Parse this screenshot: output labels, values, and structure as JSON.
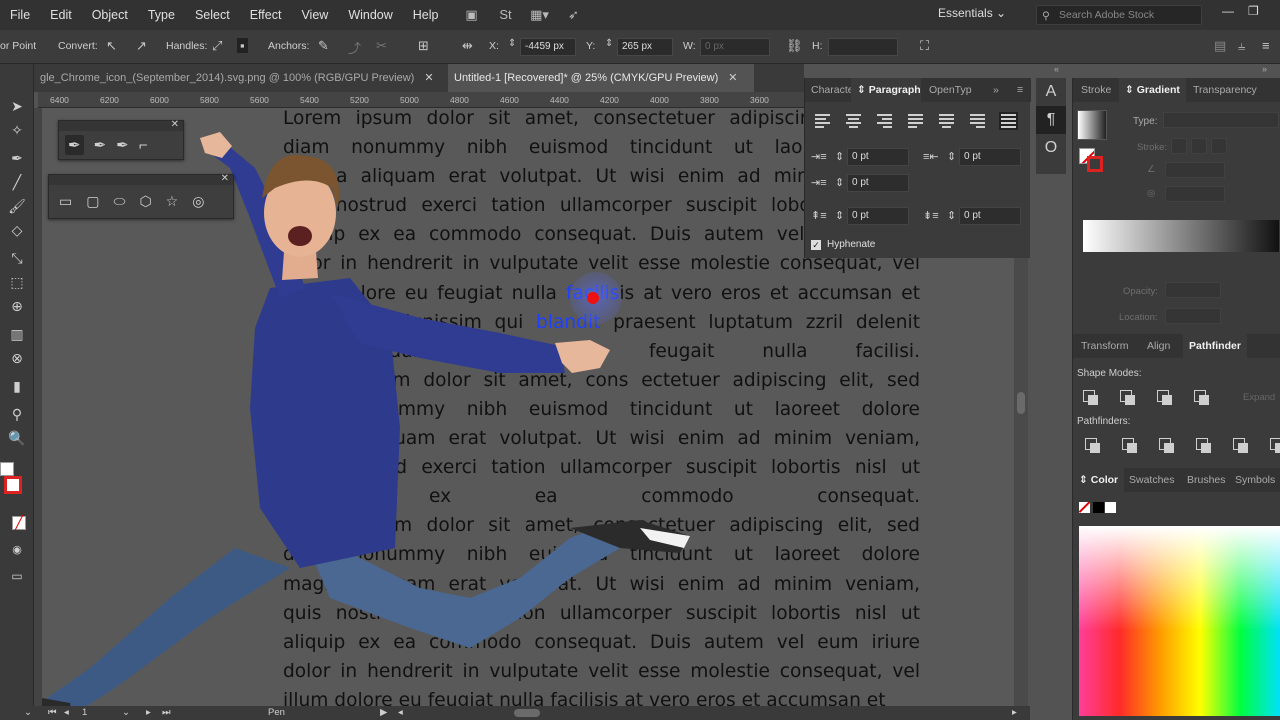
{
  "menubar": {
    "items": [
      "File",
      "Edit",
      "Object",
      "Type",
      "Select",
      "Effect",
      "View",
      "Window",
      "Help"
    ],
    "workspace": "Essentials",
    "search_placeholder": "Search Adobe Stock"
  },
  "control": {
    "anchor_point": "or Point",
    "convert": "Convert:",
    "handles": "Handles:",
    "anchors": "Anchors:",
    "x_label": "X:",
    "x_value": "-4459 px",
    "y_label": "Y:",
    "y_value": "265 px",
    "w_label": "W:",
    "w_value": "0 px",
    "h_label": "H:"
  },
  "tabs": [
    {
      "label": "gle_Chrome_icon_(September_2014).svg.png @ 100% (RGB/GPU Preview)"
    },
    {
      "label": "Untitled-1 [Recovered]* @ 25% (CMYK/GPU Preview)"
    }
  ],
  "ruler_ticks": [
    "6400",
    "6200",
    "6000",
    "5800",
    "5600",
    "5400",
    "5200",
    "5000",
    "4800",
    "4600",
    "4400",
    "4200",
    "4000",
    "3800",
    "3600"
  ],
  "canvas_text": [
    "Lorem ipsum dolor sit amet, consectetuer adipiscing elit, sed",
    "diam nonummy nibh euismod tincidunt ut laoreet dolore",
    "magna aliquam erat volutpat. Ut wisi enim ad minim veniam,",
    "quis nostrud exerci tation ullamcorper suscipit lobortis nisl ut",
    "aliquip ex ea commodo consequat. Duis autem vel eum iriure",
    "dolor in hendrerit in vulputate velit esse molestie consequat, vel",
    "illum dolore eu feugiat nulla facilisis at vero eros et accumsan et",
    "iusto odio dignissim qui blandit praesent luptatum zzril delenit",
    "augue duis dolore te feugait nulla facilisi.",
    "Lorem ipsum dolor sit amet, cons ectetuer adipiscing elit, sed",
    "diam nonummy nibh euismod tincidunt ut laoreet dolore",
    "magna aliquam erat volutpat. Ut wisi enim ad minim veniam,",
    "quis nostrud exerci tation ullamcorper suscipit lobortis nisl ut",
    "aliquip ex ea commodo consequat.",
    "Lorem ipsum dolor sit amet, consectetuer adipiscing elit, sed",
    "diam nonummy nibh euismod tincidunt ut laoreet dolore",
    "magna aliquam erat volutpat. Ut wisi enim ad minim veniam,",
    "quis nostrud exerci tation ullamcorper suscipit lobortis nisl ut",
    "aliquip ex ea commodo consequat. Duis autem vel eum iriure",
    "dolor in hendrerit in vulputate velit esse molestie consequat, vel",
    "illum dolore eu feugiat nulla facilisis at vero eros et accumsan et"
  ],
  "highlight": {
    "word1": "facilis",
    "word2": "blandit"
  },
  "paragraph_panel": {
    "tabs": [
      "Characte",
      "Paragraph",
      "OpenTyp"
    ],
    "left_indent": "0 pt",
    "right_indent": "0 pt",
    "first_line_indent": "0 pt",
    "space_before": "0 pt",
    "space_after": "0 pt",
    "hyphenate": "Hyphenate"
  },
  "gradient_panel": {
    "tabs": [
      "Stroke",
      "Gradient",
      "Transparency"
    ],
    "type_label": "Type:",
    "stroke_label": "Stroke:",
    "opacity_label": "Opacity:",
    "location_label": "Location:"
  },
  "pathfinder_panel": {
    "tabs": [
      "Transform",
      "Align",
      "Pathfinder"
    ],
    "shape_modes": "Shape Modes:",
    "pathfinders": "Pathfinders:",
    "expand": "Expand"
  },
  "color_panel": {
    "tabs": [
      "Color",
      "Swatches",
      "Brushes",
      "Symbols"
    ]
  },
  "status": {
    "page": "1",
    "tool": "Pen"
  }
}
